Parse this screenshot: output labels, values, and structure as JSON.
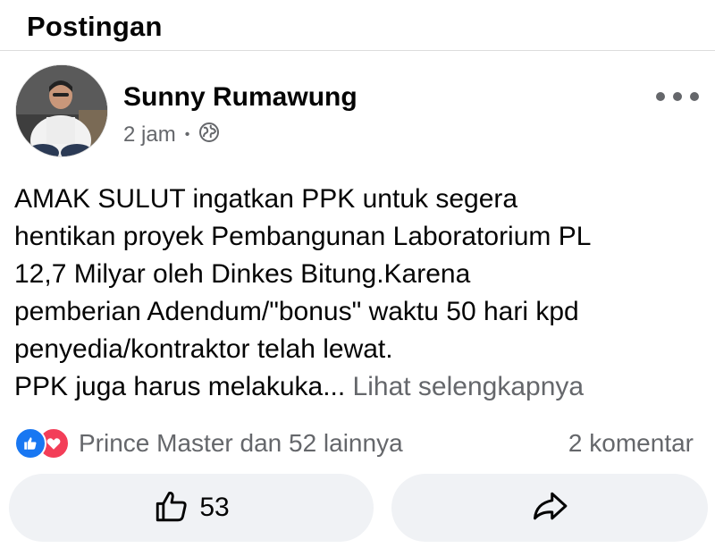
{
  "header": {
    "title": "Postingan"
  },
  "post": {
    "author": "Sunny Rumawung",
    "time": "2 jam",
    "separator": "•",
    "text": "AMAK SULUT ingatkan PPK untuk segera\nhentikan proyek Pembangunan Laboratorium PL\n12,7 Milyar oleh Dinkes Bitung.Karena\npemberian Adendum/\"bonus\" waktu 50 hari kpd\npenyedia/kontraktor telah lewat.\nPPK juga harus melakuka...",
    "see_more": "Lihat selengkapnya",
    "reactions_text": "Prince Master dan 52 lainnya",
    "comments_text": "2 komentar",
    "like_count": "53"
  },
  "icons": {
    "privacy": "globe-icon",
    "more": "more-options-icon",
    "like": "thumbs-up-icon",
    "share": "share-arrow-icon",
    "reaction_like": "like-reaction-icon",
    "reaction_love": "love-reaction-icon"
  },
  "colors": {
    "like": "#1877f2",
    "love": "#f33e58",
    "muted": "#65676b",
    "button_bg": "#f0f2f5"
  }
}
